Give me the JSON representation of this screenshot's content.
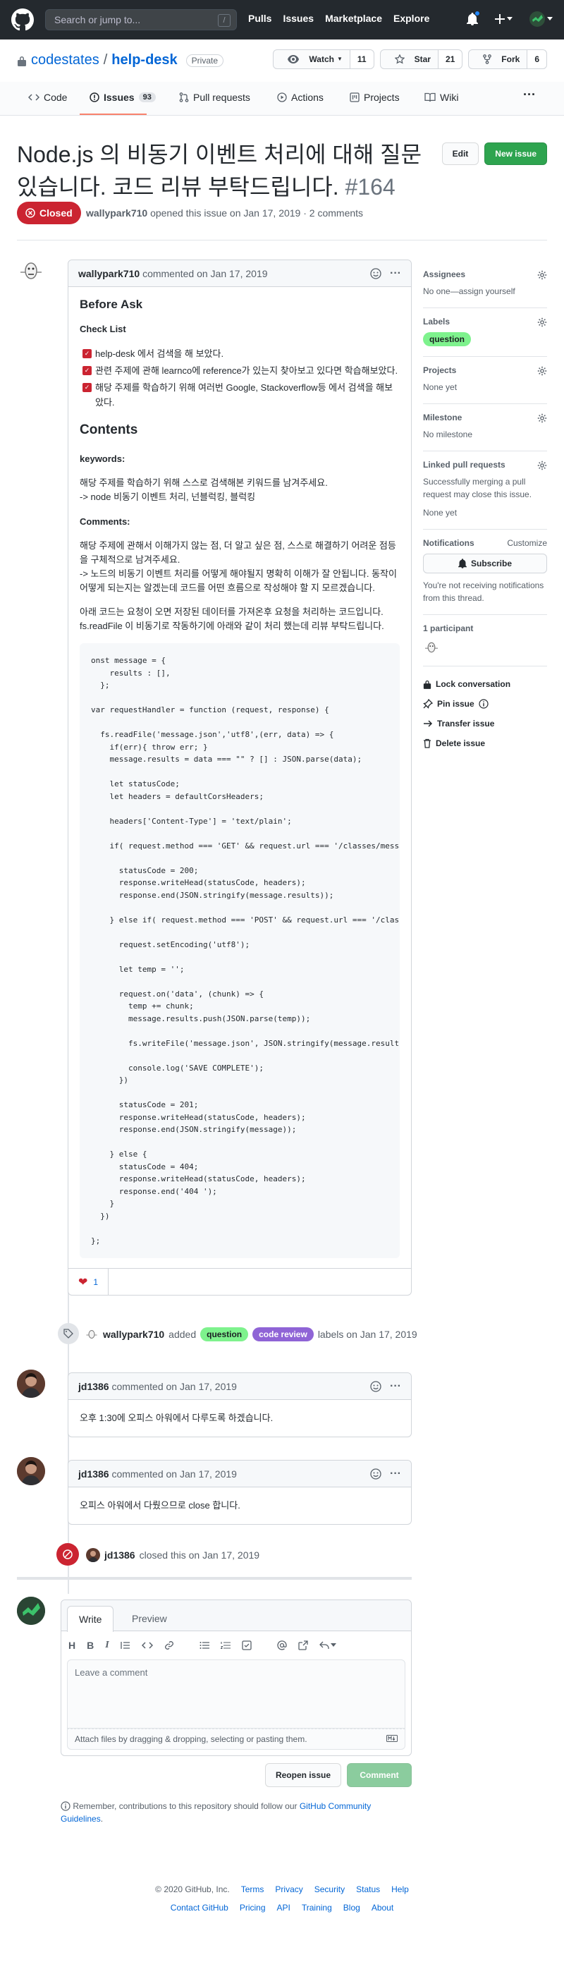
{
  "header": {
    "search_placeholder": "Search or jump to...",
    "slash": "/",
    "nav": [
      "Pulls",
      "Issues",
      "Marketplace",
      "Explore"
    ]
  },
  "repo": {
    "owner": "codestates",
    "separator": "/",
    "name": "help-desk",
    "visibility": "Private",
    "watch_label": "Watch",
    "watch_count": "11",
    "star_label": "Star",
    "star_count": "21",
    "fork_label": "Fork",
    "fork_count": "6"
  },
  "tabs": {
    "code": "Code",
    "issues": "Issues",
    "issues_count": "93",
    "pulls": "Pull requests",
    "actions": "Actions",
    "projects": "Projects",
    "wiki": "Wiki"
  },
  "issue": {
    "title": "Node.js 의 비동기 이벤트 처리에 대해 질문 있습니다. 코드 리뷰 부탁드립니다.",
    "number": "#164",
    "edit_label": "Edit",
    "new_issue_label": "New issue",
    "state": "Closed",
    "author": "wallypark710",
    "meta_text": "opened this issue on Jan 17, 2019 · 2 comments"
  },
  "comment1": {
    "author": "wallypark710",
    "date_text": "commented on Jan 17, 2019",
    "h_before": "Before Ask",
    "h_checklist": "Check List",
    "checklist": [
      "help-desk 에서 검색을 해 보았다.",
      "관련 주제에 관해 learnco에 reference가 있는지 찾아보고 있다면 학습해보았다.",
      "해당 주제를 학습하기 위해 여러번 Google, Stackoverflow등 에서 검색을 해보았다."
    ],
    "h_contents": "Contents",
    "h_keywords": "keywords:",
    "keywords_1": "해당 주제를 학습하기 위해 스스로 검색해본 키워드를 남겨주세요.",
    "keywords_2": "-> node 비동기 이벤트 처리, 넌블럭킹, 블럭킹",
    "h_comments": "Comments:",
    "comments_1": "해당 주제에 관해서 이해가지 않는 점, 더 알고 싶은 점, 스스로 해결하기 어려운 점등을 구체적으로 남겨주세요.",
    "comments_2": "-> 노드의 비동기 이벤트 처리를 어떻게 해야될지 명확히 이해가 잘 안됩니다. 동작이 어떻게 되는지는 알겠는데 코드를 어떤 흐름으로 작성해야 할 지 모르겠습니다.",
    "desc_1": "아래 코드는 요청이 오면 저장된 데이터를 가져온후 요청을 처리하는 코드입니다.",
    "desc_2": "fs.readFile 이 비동기로 작동하기에 아래와 같이 처리 했는데 리뷰 부탁드립니다.",
    "code": "onst message = {\n    results : [],\n  };\n\nvar requestHandler = function (request, response) {\n\n  fs.readFile('message.json','utf8',(err, data) => {\n    if(err){ throw err; }\n    message.results = data === \"\" ? [] : JSON.parse(data);\n\n    let statusCode;\n    let headers = defaultCorsHeaders;\n\n    headers['Content-Type'] = 'text/plain';\n\n    if( request.method === 'GET' && request.url === '/classes/messages'){\n\n      statusCode = 200;\n      response.writeHead(statusCode, headers);\n      response.end(JSON.stringify(message.results));\n\n    } else if( request.method === 'POST' && request.url === '/classes/messages'){\n\n      request.setEncoding('utf8');\n\n      let temp = '';\n\n      request.on('data', (chunk) => {\n        temp += chunk;\n        message.results.push(JSON.parse(temp));\n\n        fs.writeFile('message.json', JSON.stringify(message.results));\n\n        console.log('SAVE COMPLETE');\n      })\n\n      statusCode = 201;\n      response.writeHead(statusCode, headers);\n      response.end(JSON.stringify(message));\n\n    } else {\n      statusCode = 404;\n      response.writeHead(statusCode, headers);\n      response.end('404 ');\n    }\n  })\n\n};",
    "reaction_count": "1"
  },
  "label_event": {
    "author": "wallypark710",
    "added": "added",
    "labels": [
      "question",
      "code review"
    ],
    "suffix": "labels on Jan 17, 2019"
  },
  "comment2": {
    "author": "jd1386",
    "date_text": "commented on Jan 17, 2019",
    "body": "오후 1:30에 오피스 아워에서 다루도록 하겠습니다."
  },
  "comment3": {
    "author": "jd1386",
    "date_text": "commented on Jan 17, 2019",
    "body": "오피스 아워에서 다뤘으므로 close 합니다."
  },
  "close_event": {
    "author": "jd1386",
    "text": "closed this on Jan 17, 2019"
  },
  "editor": {
    "write_tab": "Write",
    "preview_tab": "Preview",
    "toolbar_h": "H",
    "toolbar_b": "B",
    "toolbar_i": "I",
    "placeholder": "Leave a comment",
    "attach_text": "Attach files by dragging & dropping, selecting or pasting them.",
    "reopen_label": "Reopen issue",
    "comment_label": "Comment",
    "note_text": "Remember, contributions to this repository should follow our",
    "note_link": "GitHub Community Guidelines",
    "note_end": "."
  },
  "sidebar": {
    "assignees_title": "Assignees",
    "assignees_value": "No one—assign yourself",
    "labels_title": "Labels",
    "label_question": "question",
    "projects_title": "Projects",
    "projects_value": "None yet",
    "milestone_title": "Milestone",
    "milestone_value": "No milestone",
    "linked_title": "Linked pull requests",
    "linked_desc": "Successfully merging a pull request may close this issue.",
    "linked_value": "None yet",
    "notifications_title": "Notifications",
    "customize": "Customize",
    "subscribe": "Subscribe",
    "notif_desc": "You're not receiving notifications from this thread.",
    "participants": "1 participant",
    "lock": "Lock conversation",
    "pin": "Pin issue",
    "transfer": "Transfer issue",
    "delete": "Delete issue"
  },
  "footer": {
    "copyright": "© 2020 GitHub, Inc.",
    "links_row1": [
      "Terms",
      "Privacy",
      "Security",
      "Status",
      "Help"
    ],
    "links_row2": [
      "Contact GitHub",
      "Pricing",
      "API",
      "Training",
      "Blog",
      "About"
    ]
  },
  "colors": {
    "closed": "#cb2431",
    "question_label": "#7ef28d",
    "code_review_label": "#8f64d6",
    "link": "#0366d6",
    "header_bg": "#24292e"
  }
}
